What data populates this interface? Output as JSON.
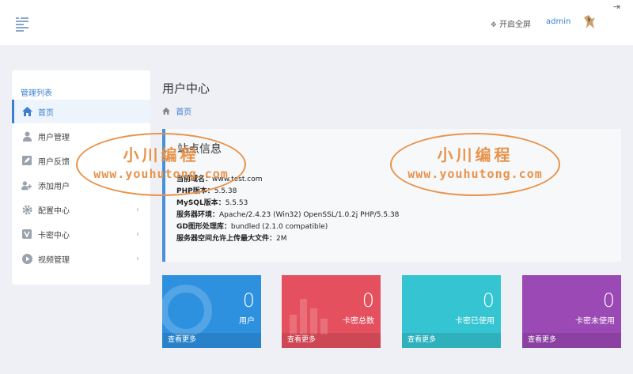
{
  "header": {
    "fullscreen_label": "开启全屏",
    "user_name": "admin"
  },
  "sidebar": {
    "title": "管理列表",
    "items": [
      {
        "label": "首页",
        "icon": "home-icon"
      },
      {
        "label": "用户管理",
        "icon": "user-icon"
      },
      {
        "label": "用户反馈",
        "icon": "edit-icon"
      },
      {
        "label": "添加用户",
        "icon": "add-user-icon"
      },
      {
        "label": "配置中心",
        "icon": "gear-icon"
      },
      {
        "label": "卡密中心",
        "icon": "v-icon"
      },
      {
        "label": "视频管理",
        "icon": "play-icon"
      }
    ]
  },
  "main": {
    "title": "用户中心",
    "breadcrumb": "首页"
  },
  "site_info": {
    "title": "站点信息",
    "lines": [
      {
        "key": "当前域名：",
        "value": "www.test.com"
      },
      {
        "key": "PHP版本：",
        "value": "5.5.38"
      },
      {
        "key": "MySQL版本：",
        "value": "5.5.53"
      },
      {
        "key": "服务器环境：",
        "value": "Apache/2.4.23 (Win32) OpenSSL/1.0.2j PHP/5.5.38"
      },
      {
        "key": "GD图形处理库：",
        "value": "bundled (2.1.0 compatible)"
      },
      {
        "key": "服务器空间允许上传最大文件：",
        "value": "2M"
      }
    ]
  },
  "watermark": {
    "line1": "小川编程",
    "line2": "www.youhutong.com"
  },
  "cards": [
    {
      "value": "0",
      "label": "用户",
      "more": "查看更多",
      "color": "#2e91e0"
    },
    {
      "value": "0",
      "label": "卡密总数",
      "more": "查看更多",
      "color": "#e5505e"
    },
    {
      "value": "0",
      "label": "卡密已使用",
      "more": "查看更多",
      "color": "#35c4d1"
    },
    {
      "value": "0",
      "label": "卡密未使用",
      "more": "查看更多",
      "color": "#9b49b5"
    }
  ]
}
